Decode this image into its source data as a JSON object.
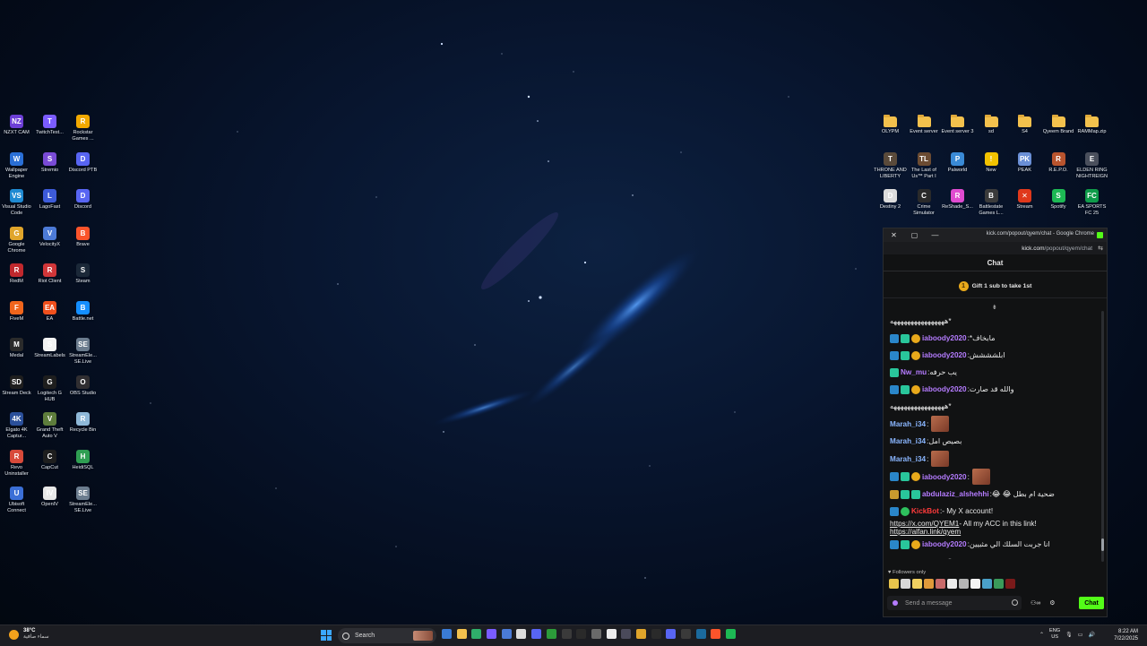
{
  "desktop_left_icons": [
    {
      "label": "NZXT CAM",
      "color": "#6d3fd6",
      "glyph": "NZ"
    },
    {
      "label": "TwitchTest...",
      "color": "#7b5cff",
      "glyph": "T"
    },
    {
      "label": "Rockstar Games ...",
      "color": "#f2a900",
      "glyph": "R"
    },
    {
      "label": "Wallpaper Engine",
      "color": "#2a6fd6",
      "glyph": "W"
    },
    {
      "label": "Stremio",
      "color": "#7a4bd6",
      "glyph": "S"
    },
    {
      "label": "Discord PTB",
      "color": "#5865f2",
      "glyph": "D"
    },
    {
      "label": "Visual Studio Code",
      "color": "#1f8ad2",
      "glyph": "VS"
    },
    {
      "label": "LagoFast",
      "color": "#3d5bd9",
      "glyph": "L"
    },
    {
      "label": "Discord",
      "color": "#5865f2",
      "glyph": "D"
    },
    {
      "label": "Google Chrome",
      "color": "#e0a52b",
      "glyph": "G"
    },
    {
      "label": "VelocityX",
      "color": "#4c7ad6",
      "glyph": "V"
    },
    {
      "label": "Brave",
      "color": "#fb542b",
      "glyph": "B"
    },
    {
      "label": "RedM",
      "color": "#c0282d",
      "glyph": "R"
    },
    {
      "label": "Riot Client",
      "color": "#d13639",
      "glyph": "R"
    },
    {
      "label": "Steam",
      "color": "#1b2838",
      "glyph": "S"
    },
    {
      "label": "FiveM",
      "color": "#f0651c",
      "glyph": "F"
    },
    {
      "label": "EA",
      "color": "#f0501d",
      "glyph": "EA"
    },
    {
      "label": "Battle.net",
      "color": "#148eff",
      "glyph": "B"
    },
    {
      "label": "Medal",
      "color": "#2b2b2b",
      "glyph": "M"
    },
    {
      "label": "StreamLabels",
      "color": "#f3f3f3",
      "glyph": "S"
    },
    {
      "label": "StreamEle... SE.Live",
      "color": "#6b7c8e",
      "glyph": "SE"
    },
    {
      "label": "Stream Deck",
      "color": "#1e1e1e",
      "glyph": "SD"
    },
    {
      "label": "Logitech G HUB",
      "color": "#1e1e1e",
      "glyph": "G"
    },
    {
      "label": "OBS Studio",
      "color": "#302e31",
      "glyph": "O"
    },
    {
      "label": "Elgato 4K Captur...",
      "color": "#2a4f9a",
      "glyph": "4K"
    },
    {
      "label": "Grand Theft Auto V",
      "color": "#5e7d3c",
      "glyph": "V"
    },
    {
      "label": "Recycle Bin",
      "color": "#8fb8d8",
      "glyph": "R"
    },
    {
      "label": "Revo Uninstaller",
      "color": "#d84a3a",
      "glyph": "R"
    },
    {
      "label": "CapCut",
      "color": "#1e1e1e",
      "glyph": "C"
    },
    {
      "label": "HeidiSQL",
      "color": "#2f9e52",
      "glyph": "H"
    },
    {
      "label": "Ubisoft Connect",
      "color": "#3b6fd6",
      "glyph": "U"
    },
    {
      "label": "OpenIV",
      "color": "#e8e8e8",
      "glyph": "IV"
    },
    {
      "label": "StreamEle... SE.Live",
      "color": "#6b7c8e",
      "glyph": "SE"
    }
  ],
  "desktop_right_icons": [
    {
      "label": "OLYPM",
      "type": "folder"
    },
    {
      "label": "Event server",
      "type": "folder"
    },
    {
      "label": "Event server 3",
      "type": "folder"
    },
    {
      "label": "sd",
      "type": "folder"
    },
    {
      "label": "S4",
      "type": "folder"
    },
    {
      "label": "Qyeem Brand",
      "type": "folder"
    },
    {
      "label": "RAMMap.zip",
      "type": "folder"
    },
    {
      "label": "THRONE AND LIBERTY",
      "color": "#5a4a3a",
      "glyph": "T"
    },
    {
      "label": "The Last of Us™ Part I",
      "color": "#6b4b32",
      "glyph": "TL"
    },
    {
      "label": "Palworld",
      "color": "#3a8ad6",
      "glyph": "P"
    },
    {
      "label": "New",
      "color": "#f2c200",
      "glyph": "!"
    },
    {
      "label": "PEAK",
      "color": "#6a8fd6",
      "glyph": "PK"
    },
    {
      "label": "R.E.P.O.",
      "color": "#b9542e",
      "glyph": "R"
    },
    {
      "label": "ELDEN RING NIGHTREIGN",
      "color": "#4a4f5c",
      "glyph": "E"
    },
    {
      "label": "Destiny 2",
      "color": "#dcdcdc",
      "glyph": "D"
    },
    {
      "label": "Crime Simulator",
      "color": "#2a2a2a",
      "glyph": "C"
    },
    {
      "label": "ReShade_S...",
      "color": "#e04bd0",
      "glyph": "R"
    },
    {
      "label": "Battlestate Games L...",
      "color": "#3b3b3b",
      "glyph": "B"
    },
    {
      "label": "Stream",
      "color": "#e0381b",
      "glyph": "✕"
    },
    {
      "label": "Spotify",
      "color": "#1db954",
      "glyph": "S"
    },
    {
      "label": "EA SPORTS FC 25",
      "color": "#0f9b4a",
      "glyph": "FC"
    }
  ],
  "popup": {
    "window_title": "kick.com/popout/qyem/chat - Google Chrome",
    "url_domain": "kick.com",
    "url_path": "/popout/qyem/chat",
    "chat_header": "Chat",
    "gift_text": "Gift 1 sub to take 1st",
    "followers_only": "Followers only",
    "input_placeholder": "Send a message",
    "chat_button": "Chat",
    "accent": "#53fc18"
  },
  "messages": [
    {
      "badges": [],
      "user": "",
      "user_color": "",
      "text": "*ههههههههههههههههه"
    },
    {
      "badges": [
        "mod",
        "vip",
        "sub"
      ],
      "user": "iaboody2020",
      "user_color": "purple",
      "text": "مابخاف*"
    },
    {
      "badges": [
        "mod",
        "vip",
        "sub"
      ],
      "user": "iaboody2020",
      "user_color": "purple",
      "text": "ابلشششش"
    },
    {
      "badges": [
        "vip"
      ],
      "user": "Nw_mu",
      "user_color": "purple",
      "text": "يب حرفه"
    },
    {
      "badges": [
        "mod",
        "vip",
        "sub"
      ],
      "user": "iaboody2020",
      "user_color": "purple",
      "text": "والله قد صارت"
    },
    {
      "badges": [],
      "user": "",
      "user_color": "",
      "text": "*ههههههههههههههههه"
    },
    {
      "badges": [],
      "user": "Marah_i34",
      "user_color": "blue",
      "text": "",
      "emote": true
    },
    {
      "badges": [],
      "user": "Marah_i34",
      "user_color": "blue",
      "text": "بصيص امل"
    },
    {
      "badges": [],
      "user": "Marah_i34",
      "user_color": "blue",
      "text": "",
      "emote": true
    },
    {
      "badges": [
        "mod",
        "vip",
        "sub"
      ],
      "user": "iaboody2020",
      "user_color": "purple",
      "text": "",
      "emote": true
    },
    {
      "badges": [
        "crown",
        "vip",
        "glyph"
      ],
      "user": "abdulaziz_alshehhi",
      "user_color": "purple",
      "text": "ضحية ام بطل 😂 😂"
    },
    {
      "badges": [
        "mod",
        "ver"
      ],
      "user": "KickBot",
      "user_color": "red",
      "text": "- My X account!"
    },
    {
      "badges": [],
      "user": "",
      "user_color": "",
      "text": "- All my ACC in this link!",
      "link": "https://x.com/QYEM1"
    },
    {
      "badges": [],
      "user": "",
      "user_color": "",
      "text": "",
      "link": "https://alfan.link/qyem"
    },
    {
      "badges": [
        "mod",
        "vip",
        "sub"
      ],
      "user": "iaboody2020",
      "user_color": "purple",
      "text": "انا جربت السلك الي مثبيين"
    },
    {
      "badges": [],
      "user": "",
      "user_color": "",
      "text": "*ههههههههههههههههه"
    }
  ],
  "taskbar": {
    "temperature": "38°C",
    "weather_text": "سماء صافية",
    "search_label": "Search",
    "lang_1": "ENG",
    "lang_2": "US",
    "time": "8:22 AM",
    "date": "7/22/2025"
  }
}
